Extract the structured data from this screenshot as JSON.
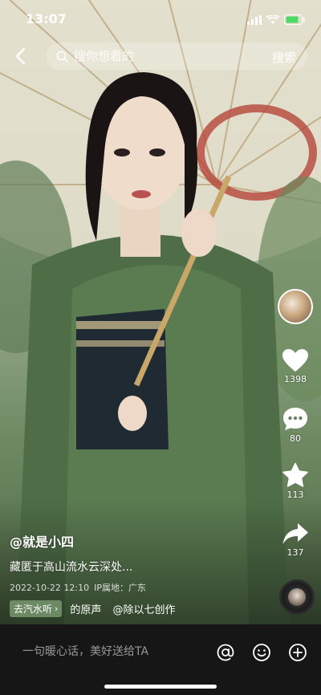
{
  "status_bar": {
    "time": "13:07"
  },
  "search": {
    "placeholder": "搜你想看的",
    "button_label": "搜索"
  },
  "actions": {
    "like_count": "1398",
    "comment_count": "80",
    "favorite_count": "113",
    "share_count": "137"
  },
  "post": {
    "author": "@就是小四",
    "description": "藏匿于高山流水云深处...",
    "date": "2022-10-22 12:10",
    "location": "IP属地：广东",
    "music_tag": "去汽水听",
    "music_text": "的原声",
    "music_creator": "@除以七创作"
  },
  "comment_bar": {
    "placeholder": "一句暖心话，美好送给TA"
  },
  "icons": [
    "back-icon",
    "search-icon",
    "heart-icon",
    "comment-icon",
    "star-icon",
    "share-icon",
    "at-icon",
    "emoji-icon",
    "plus-icon",
    "signal-icon",
    "wifi-icon",
    "battery-icon"
  ],
  "colors": {
    "tag_bg": "#789670",
    "bottom_bar": "#161616",
    "battery_green": "#4cd964"
  }
}
